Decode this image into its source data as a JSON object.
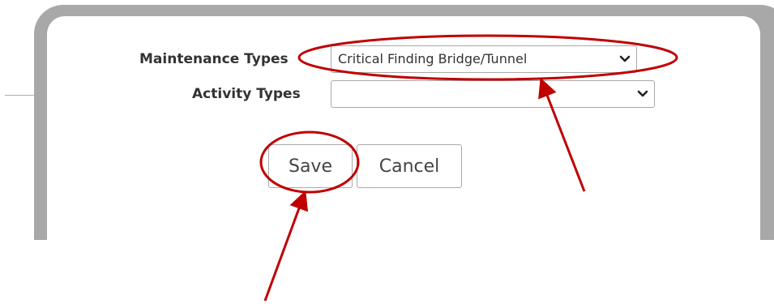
{
  "form": {
    "maintenance_types": {
      "label": "Maintenance Types",
      "selected": "Critical Finding Bridge/Tunnel"
    },
    "activity_types": {
      "label": "Activity Types",
      "selected": ""
    }
  },
  "buttons": {
    "save_label": "Save",
    "cancel_label": "Cancel"
  },
  "annotation": {
    "color": "#c00000"
  },
  "icons": {
    "select_arrow": "chevron-down-icon"
  }
}
